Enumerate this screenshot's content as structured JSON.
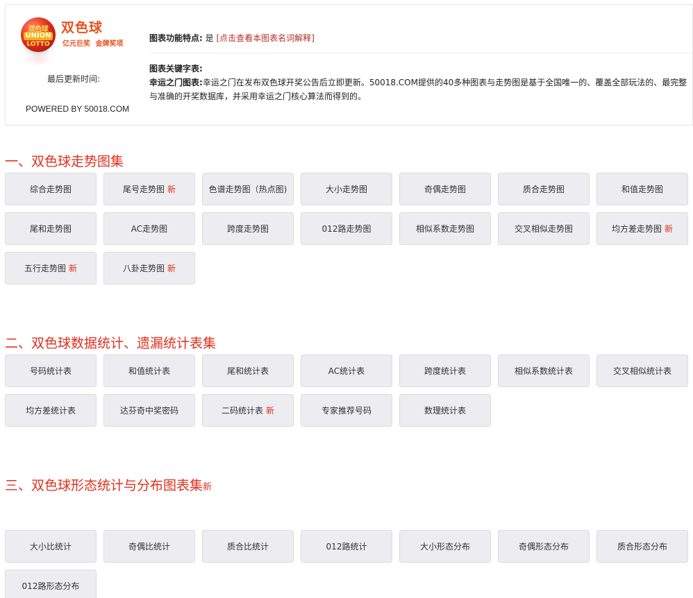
{
  "header": {
    "logo": {
      "text_top": "双色球",
      "text_mid": "UNION",
      "text_bot": "LOTTO"
    },
    "brand_name": "双色球",
    "slogan": "亿元巨奖  金牌奖项",
    "last_updated_label": "最后更新时间:",
    "powered_by": "POWERED BY 50018.COM",
    "features_label": "图表功能特点:",
    "features_value": "是",
    "features_link": "点击查看本图表名词解释",
    "keywords_title": "图表关键字表:",
    "keywords_lead": "幸运之门图表:",
    "keywords_text": "幸运之门在发布双色球开奖公告后立即更新。50018.COM提供的40多种图表与走势图是基于全国唯一的、覆盖全部玩法的、最完整与准确的开奖数据库，并采用幸运之门核心算法而得到的。"
  },
  "new_label": "新",
  "sections": [
    {
      "title": "一、双色球走势图集",
      "buttons": [
        {
          "label": "综合走势图"
        },
        {
          "label": "尾号走势图",
          "new": true
        },
        {
          "label": "色谱走势图（热点图)"
        },
        {
          "label": "大小走势图"
        },
        {
          "label": "奇偶走势图"
        },
        {
          "label": "质合走势图"
        },
        {
          "label": "和值走势图"
        },
        {
          "label": "尾和走势图"
        },
        {
          "label": "AC走势图"
        },
        {
          "label": "跨度走势图"
        },
        {
          "label": "012路走势图"
        },
        {
          "label": "相似系数走势图"
        },
        {
          "label": "交叉相似走势图"
        },
        {
          "label": "均方差走势图",
          "new": true
        },
        {
          "label": "五行走势图",
          "new": true
        },
        {
          "label": "八卦走势图",
          "new": true
        }
      ]
    },
    {
      "title": "二、双色球数据统计、遗漏统计表集",
      "buttons": [
        {
          "label": "号码统计表"
        },
        {
          "label": "和值统计表"
        },
        {
          "label": "尾和统计表"
        },
        {
          "label": "AC统计表"
        },
        {
          "label": "跨度统计表"
        },
        {
          "label": "相似系数统计表"
        },
        {
          "label": "交叉相似统计表"
        },
        {
          "label": "均方差统计表"
        },
        {
          "label": "达芬奇中奖密码"
        },
        {
          "label": "二码统计表",
          "new": true
        },
        {
          "label": "专家推荐号码"
        },
        {
          "label": "数理统计表"
        }
      ]
    },
    {
      "title": "三、双色球形态统计与分布图表集",
      "title_new": "新",
      "buttons": [
        {
          "label": "大小比统计"
        },
        {
          "label": "奇偶比统计"
        },
        {
          "label": "质合比统计"
        },
        {
          "label": "012路统计"
        },
        {
          "label": "大小形态分布"
        },
        {
          "label": "奇偶形态分布"
        },
        {
          "label": "质合形态分布"
        },
        {
          "label": "012路形态分布"
        }
      ]
    }
  ]
}
